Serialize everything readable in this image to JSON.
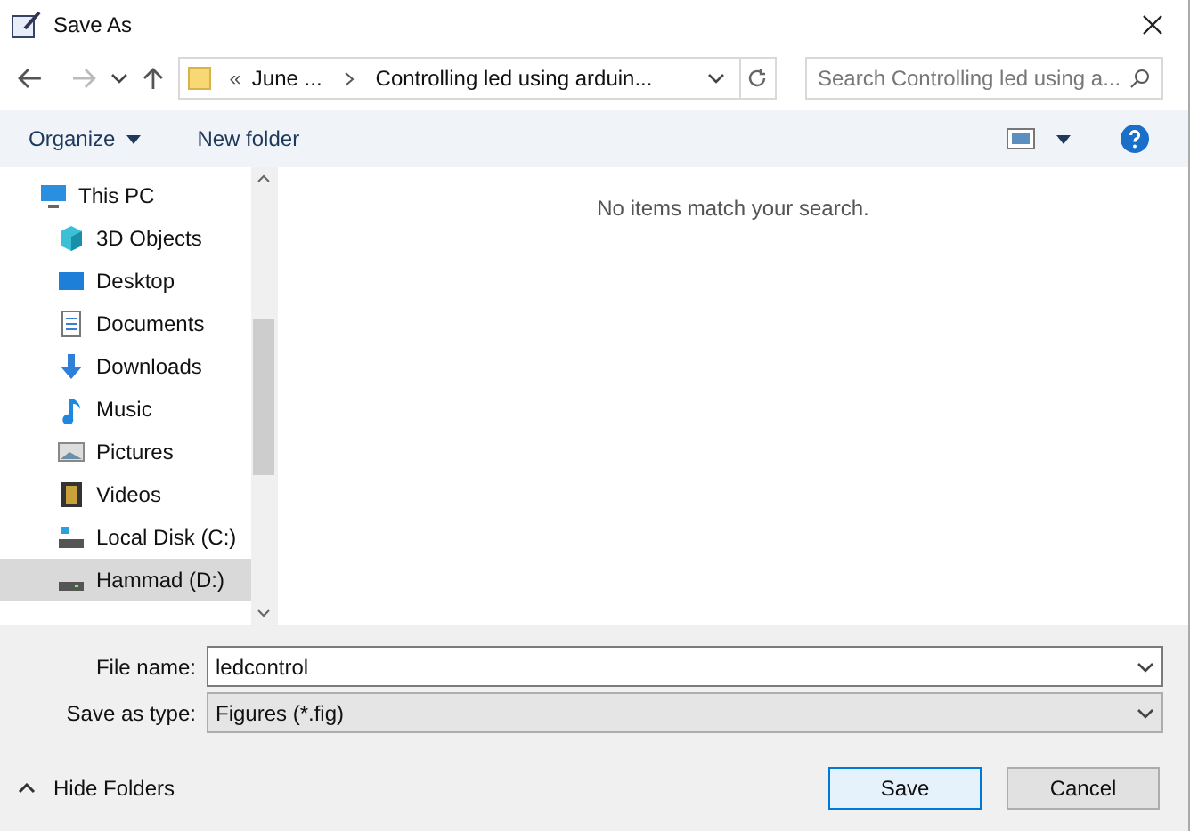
{
  "window": {
    "title": "Save As"
  },
  "address_bar": {
    "overflow": "«",
    "crumbs": [
      "June ...",
      "Controlling led using arduin..."
    ]
  },
  "search": {
    "placeholder": "Search Controlling led using a..."
  },
  "toolbar": {
    "organize": "Organize",
    "new_folder": "New folder"
  },
  "sidebar": {
    "items": [
      {
        "label": "This PC",
        "kind": "pc",
        "selected": false,
        "children": [
          {
            "label": "3D Objects",
            "kind": "cube",
            "selected": false
          },
          {
            "label": "Desktop",
            "kind": "desktop",
            "selected": false
          },
          {
            "label": "Documents",
            "kind": "document",
            "selected": false
          },
          {
            "label": "Downloads",
            "kind": "download",
            "selected": false
          },
          {
            "label": "Music",
            "kind": "music",
            "selected": false
          },
          {
            "label": "Pictures",
            "kind": "picture",
            "selected": false
          },
          {
            "label": "Videos",
            "kind": "video",
            "selected": false
          },
          {
            "label": "Local Disk (C:)",
            "kind": "system-drive",
            "selected": false
          },
          {
            "label": "Hammad (D:)",
            "kind": "drive",
            "selected": true
          }
        ]
      }
    ]
  },
  "content": {
    "empty_message": "No items match your search."
  },
  "form": {
    "file_name_label": "File name:",
    "file_name": "ledcontrol",
    "type_label": "Save as type:",
    "type": "Figures (*.fig)"
  },
  "hide_folders": "Hide Folders",
  "buttons": [
    {
      "label": "Save",
      "kind": "primary"
    },
    {
      "label": "Cancel",
      "kind": "normal"
    }
  ]
}
